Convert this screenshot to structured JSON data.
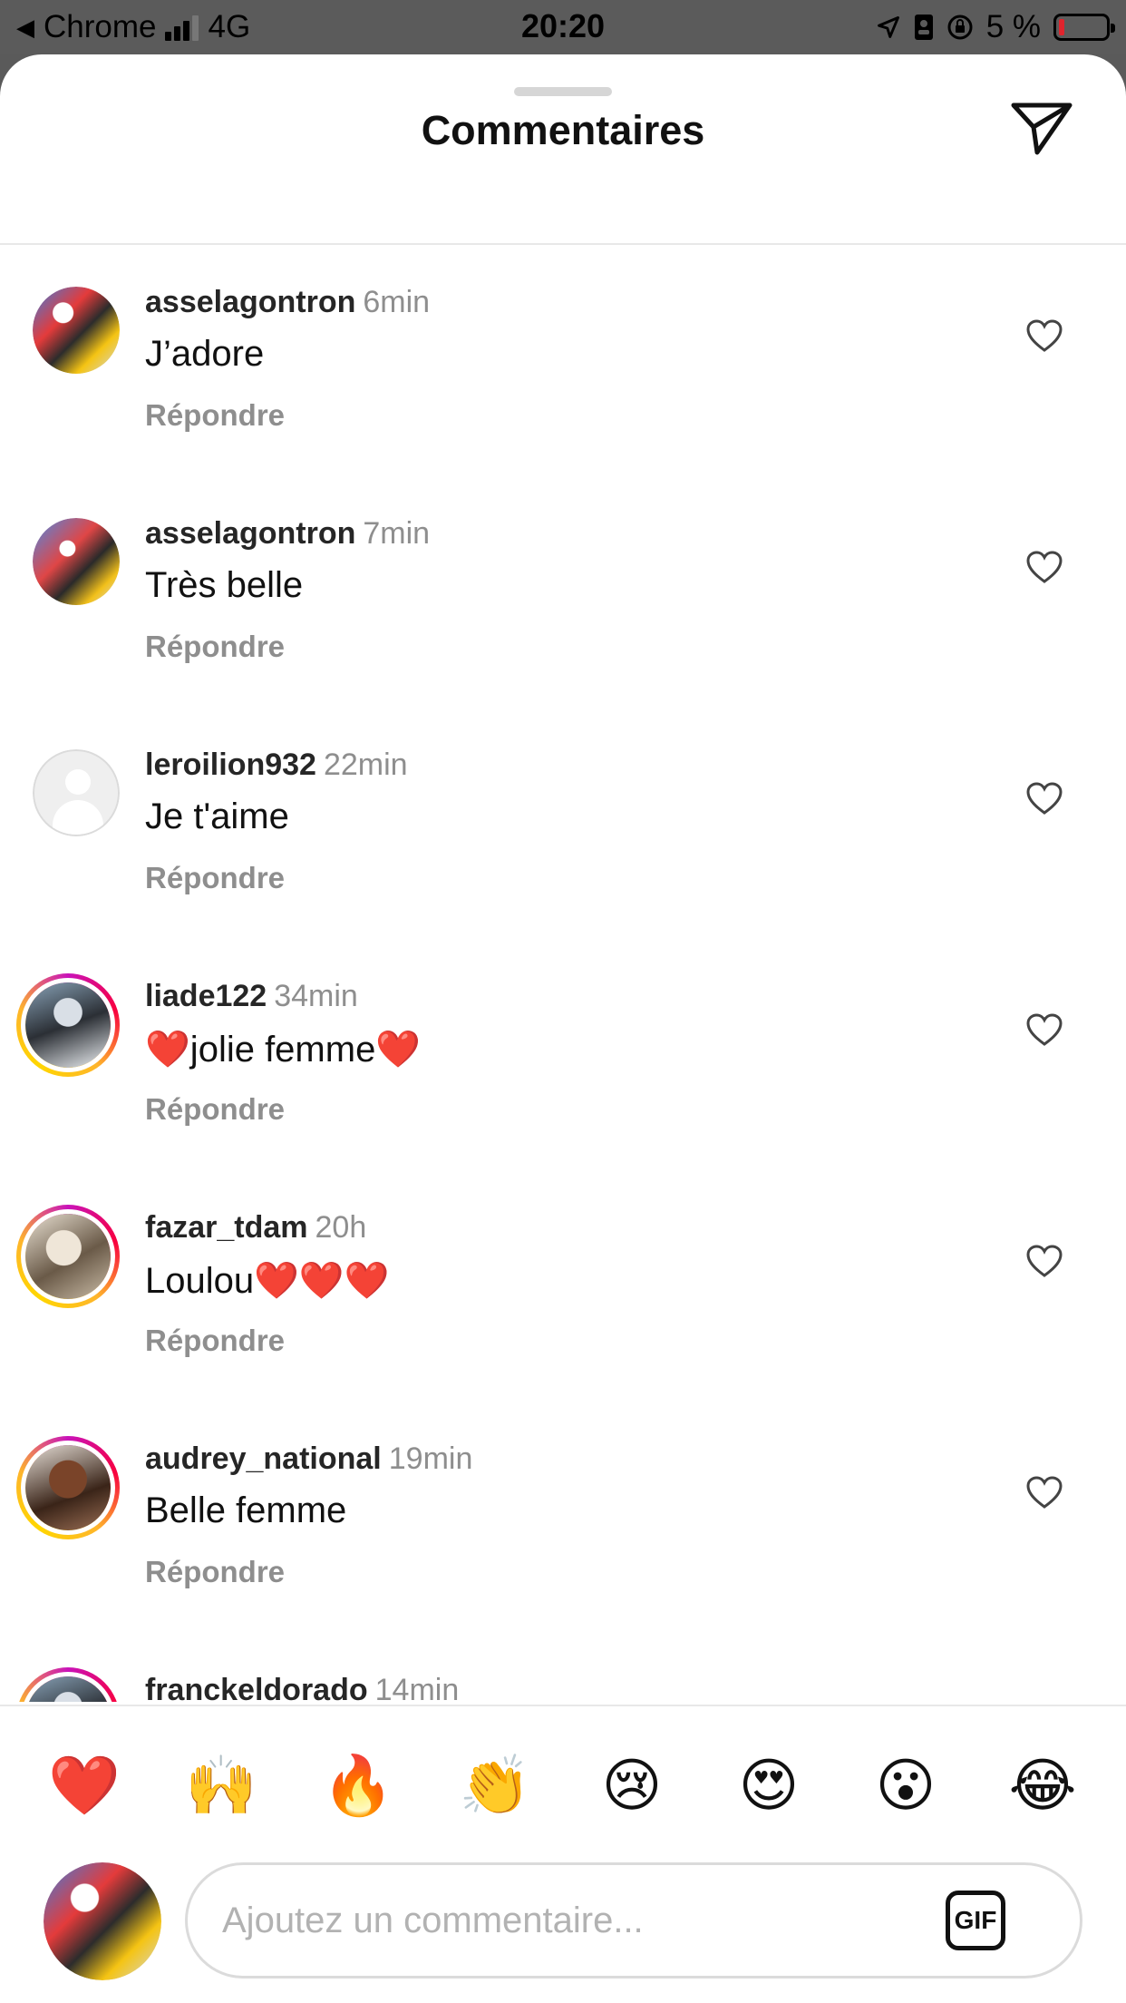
{
  "status_bar": {
    "back_app": "Chrome",
    "network": "4G",
    "time": "20:20",
    "battery_percent": "5 %"
  },
  "header": {
    "title": "Commentaires",
    "share_icon": "send-icon"
  },
  "comments": [
    {
      "username": "asselagontron",
      "time": "6min",
      "text": "J’adore",
      "reply_label": "Répondre",
      "has_story_ring": false
    },
    {
      "username": "asselagontron",
      "time": "7min",
      "text": "Très belle",
      "reply_label": "Répondre",
      "has_story_ring": false
    },
    {
      "username": "leroilion932",
      "time": "22min",
      "text": "Je t'aime",
      "reply_label": "Répondre",
      "has_story_ring": false
    },
    {
      "username": "liade122",
      "time": "34min",
      "text": "❤️jolie femme❤️",
      "reply_label": "Répondre",
      "has_story_ring": true
    },
    {
      "username": "fazar_tdam",
      "time": "20h",
      "text": "Loulou❤️❤️❤️",
      "reply_label": "Répondre",
      "has_story_ring": true
    },
    {
      "username": "audrey_national",
      "time": "19min",
      "text": "Belle femme",
      "reply_label": "Répondre",
      "has_story_ring": true
    },
    {
      "username": "franckeldorado",
      "time": "14min",
      "text": "",
      "reply_label": "",
      "has_story_ring": true
    }
  ],
  "quick_reactions": [
    "❤️",
    "🙌",
    "🔥",
    "👏",
    "😢",
    "😍",
    "😮",
    "😂"
  ],
  "composer": {
    "placeholder": "Ajoutez un commentaire...",
    "gif_label": "GIF"
  },
  "colors": {
    "story_ring": [
      "#c913b9",
      "#f8003f",
      "#feb52b"
    ],
    "muted_text": "#8e8e8e",
    "battery_low": "#e0242d"
  }
}
